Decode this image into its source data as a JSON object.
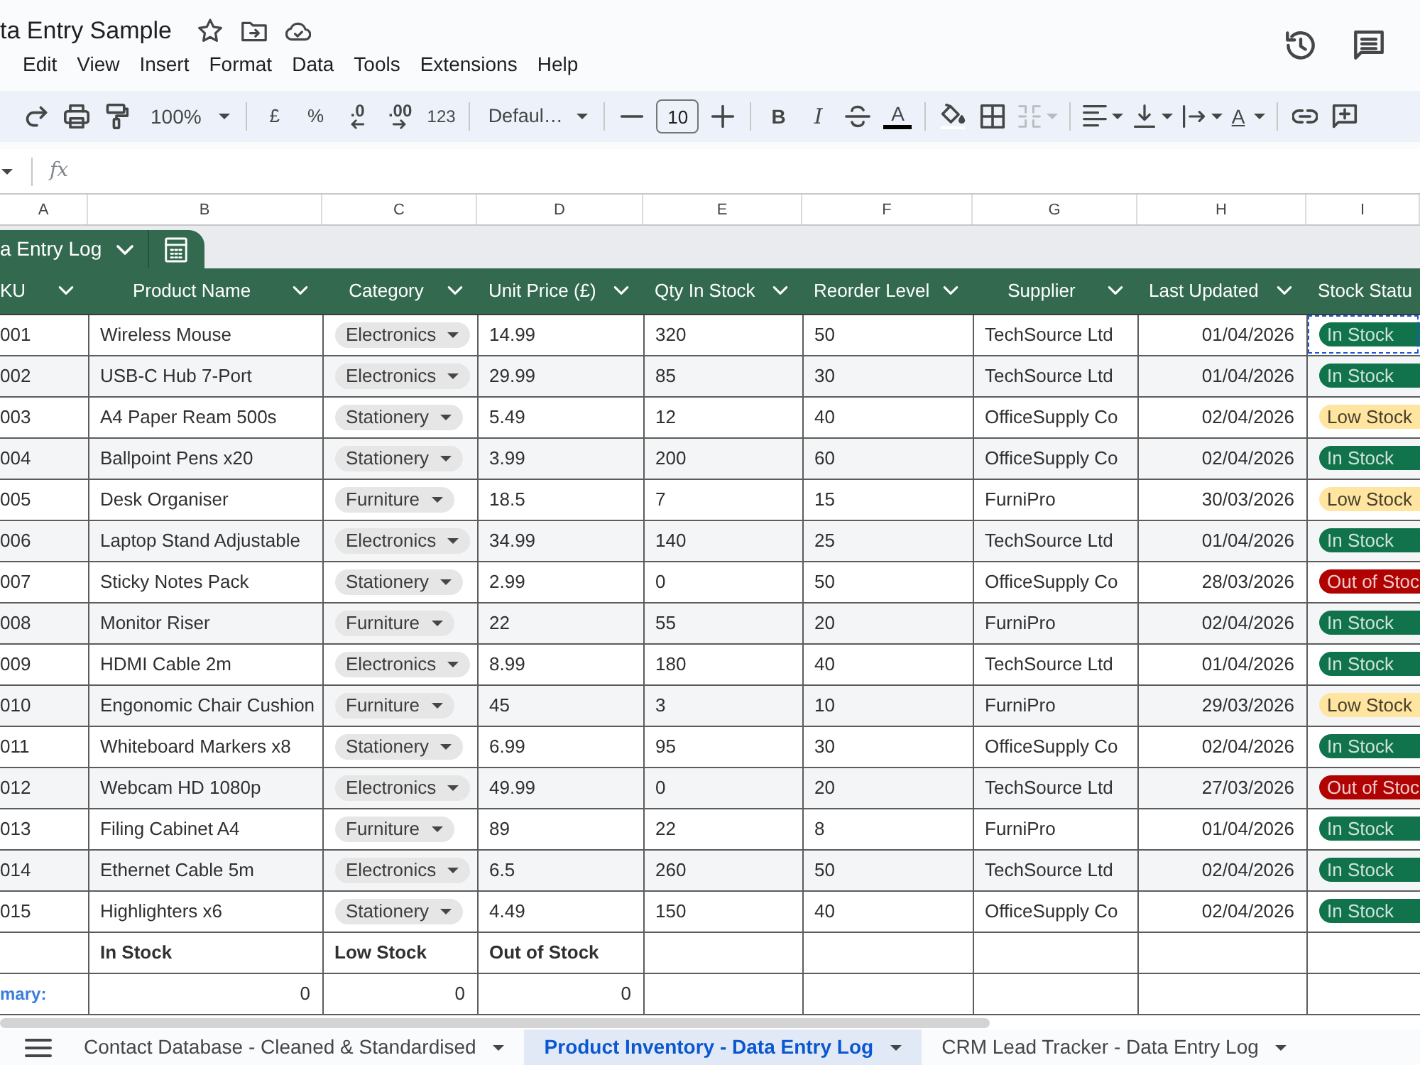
{
  "document": {
    "title": "ta Entry Sample"
  },
  "menu": [
    "Edit",
    "View",
    "Insert",
    "Format",
    "Data",
    "Tools",
    "Extensions",
    "Help"
  ],
  "toolbar": {
    "zoom": "100%",
    "currency": "£",
    "percent": "%",
    "decrease_decimal": ".0",
    "increase_decimal": ".00",
    "number_format": "123",
    "font": "Defaul…",
    "font_size": "10",
    "bold": "B",
    "italic": "I",
    "text_color": "A",
    "merge": {
      "disabled": true
    },
    "text_rotation": "A"
  },
  "formula_bar": {
    "function_label": "fx"
  },
  "column_letters": [
    "A",
    "B",
    "C",
    "D",
    "E",
    "F",
    "G",
    "H",
    "I"
  ],
  "table": {
    "name": "a Entry Log",
    "columns": [
      "KU",
      "Product Name",
      "Category",
      "Unit Price (£)",
      "Qty In Stock",
      "Reorder Level",
      "Supplier",
      "Last Updated",
      "Stock Statu"
    ],
    "rows": [
      {
        "sku": "001",
        "product_name": "Wireless Mouse",
        "category": "Electronics",
        "unit_price": "14.99",
        "qty_in_stock": "320",
        "reorder_level": "50",
        "supplier": "TechSource Ltd",
        "last_updated": "01/04/2026",
        "stock_status": {
          "text": "In Stock",
          "color": "#11734b",
          "copied": true
        }
      },
      {
        "sku": "002",
        "product_name": "USB-C Hub 7-Port",
        "category": "Electronics",
        "unit_price": "29.99",
        "qty_in_stock": "85",
        "reorder_level": "30",
        "supplier": "TechSource Ltd",
        "last_updated": "01/04/2026",
        "stock_status": {
          "text": "In Stock",
          "color": "#11734b",
          "copied": false
        }
      },
      {
        "sku": "003",
        "product_name": "A4 Paper Ream 500s",
        "category": "Stationery",
        "unit_price": "5.49",
        "qty_in_stock": "12",
        "reorder_level": "40",
        "supplier": "OfficeSupply Co",
        "last_updated": "02/04/2026",
        "stock_status": {
          "text": "Low Stock",
          "color": "#ffe5a0",
          "copied": false
        }
      },
      {
        "sku": "004",
        "product_name": "Ballpoint Pens x20",
        "category": "Stationery",
        "unit_price": "3.99",
        "qty_in_stock": "200",
        "reorder_level": "60",
        "supplier": "OfficeSupply Co",
        "last_updated": "02/04/2026",
        "stock_status": {
          "text": "In Stock",
          "color": "#11734b",
          "copied": false
        }
      },
      {
        "sku": "005",
        "product_name": "Desk Organiser",
        "category": "Furniture",
        "unit_price": "18.5",
        "qty_in_stock": "7",
        "reorder_level": "15",
        "supplier": "FurniPro",
        "last_updated": "30/03/2026",
        "stock_status": {
          "text": "Low Stock",
          "color": "#ffe5a0",
          "copied": false
        }
      },
      {
        "sku": "006",
        "product_name": "Laptop Stand Adjustable",
        "category": "Electronics",
        "unit_price": "34.99",
        "qty_in_stock": "140",
        "reorder_level": "25",
        "supplier": "TechSource Ltd",
        "last_updated": "01/04/2026",
        "stock_status": {
          "text": "In Stock",
          "color": "#11734b",
          "copied": false
        }
      },
      {
        "sku": "007",
        "product_name": "Sticky Notes Pack",
        "category": "Stationery",
        "unit_price": "2.99",
        "qty_in_stock": "0",
        "reorder_level": "50",
        "supplier": "OfficeSupply Co",
        "last_updated": "28/03/2026",
        "stock_status": {
          "text": "Out of Stoc",
          "color": "#b10202",
          "copied": false
        }
      },
      {
        "sku": "008",
        "product_name": "Monitor Riser",
        "category": "Furniture",
        "unit_price": "22",
        "qty_in_stock": "55",
        "reorder_level": "20",
        "supplier": "FurniPro",
        "last_updated": "02/04/2026",
        "stock_status": {
          "text": "In Stock",
          "color": "#11734b",
          "copied": false
        }
      },
      {
        "sku": "009",
        "product_name": "HDMI Cable 2m",
        "category": "Electronics",
        "unit_price": "8.99",
        "qty_in_stock": "180",
        "reorder_level": "40",
        "supplier": "TechSource Ltd",
        "last_updated": "01/04/2026",
        "stock_status": {
          "text": "In Stock",
          "color": "#11734b",
          "copied": false
        }
      },
      {
        "sku": "010",
        "product_name": "Engonomic Chair Cushion",
        "category": "Furniture",
        "unit_price": "45",
        "qty_in_stock": "3",
        "reorder_level": "10",
        "supplier": "FurniPro",
        "last_updated": "29/03/2026",
        "stock_status": {
          "text": "Low Stock",
          "color": "#ffe5a0",
          "copied": false
        }
      },
      {
        "sku": "011",
        "product_name": "Whiteboard Markers x8",
        "category": "Stationery",
        "unit_price": "6.99",
        "qty_in_stock": "95",
        "reorder_level": "30",
        "supplier": "OfficeSupply Co",
        "last_updated": "02/04/2026",
        "stock_status": {
          "text": "In Stock",
          "color": "#11734b",
          "copied": false
        }
      },
      {
        "sku": "012",
        "product_name": "Webcam HD 1080p",
        "category": "Electronics",
        "unit_price": "49.99",
        "qty_in_stock": "0",
        "reorder_level": "20",
        "supplier": "TechSource Ltd",
        "last_updated": "27/03/2026",
        "stock_status": {
          "text": "Out of Stoc",
          "color": "#b10202",
          "copied": false
        }
      },
      {
        "sku": "013",
        "product_name": "Filing Cabinet A4",
        "category": "Furniture",
        "unit_price": "89",
        "qty_in_stock": "22",
        "reorder_level": "8",
        "supplier": "FurniPro",
        "last_updated": "01/04/2026",
        "stock_status": {
          "text": "In Stock",
          "color": "#11734b",
          "copied": false
        }
      },
      {
        "sku": "014",
        "product_name": "Ethernet Cable 5m",
        "category": "Electronics",
        "unit_price": "6.5",
        "qty_in_stock": "260",
        "reorder_level": "50",
        "supplier": "TechSource Ltd",
        "last_updated": "02/04/2026",
        "stock_status": {
          "text": "In Stock",
          "color": "#11734b",
          "copied": false
        }
      },
      {
        "sku": "015",
        "product_name": "Highlighters x6",
        "category": "Stationery",
        "unit_price": "4.49",
        "qty_in_stock": "150",
        "reorder_level": "40",
        "supplier": "OfficeSupply Co",
        "last_updated": "02/04/2026",
        "stock_status": {
          "text": "In Stock",
          "color": "#11734b",
          "copied": false
        }
      }
    ]
  },
  "summary": {
    "headings": [
      "In Stock",
      "Low Stock",
      "Out of Stock"
    ],
    "label": "mary:",
    "counts": [
      "0",
      "0",
      "0"
    ]
  },
  "sheet_tabs": [
    {
      "label": "Contact Database - Cleaned & Standardised",
      "selected": false
    },
    {
      "label": "Product Inventory - Data Entry Log",
      "selected": true
    },
    {
      "label": "CRM Lead Tracker - Data Entry Log",
      "selected": false
    }
  ]
}
